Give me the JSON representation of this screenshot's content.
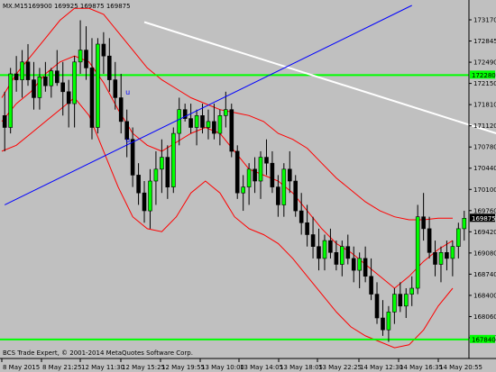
{
  "header": {
    "symbol": "MX.M15",
    "ohlc": "169900 169925 169875 169875"
  },
  "footer": {
    "copyright": "BCS Trade Expert, © 2001-2014 MetaQuotes Software Corp."
  },
  "colors": {
    "background": "#c0c0c0",
    "bull_body": "#00ff00",
    "bear_body": "#000000",
    "bollinger": "#ff0000",
    "hline": "#00ff00",
    "trendline_down": "#ffffff",
    "trendline_up": "#ffff00",
    "trendline_blue": "#0000ff"
  },
  "price_axis": {
    "labels": [
      "173170",
      "172845",
      "172490",
      "172150",
      "171810",
      "171120",
      "170780",
      "170440",
      "170100",
      "169760",
      "169420",
      "169080",
      "168740",
      "168400",
      "168060",
      "167720"
    ],
    "current_price": "169875",
    "hline_upper_tag": "172280",
    "hline_lower_tag": "167840"
  },
  "time_axis": {
    "labels": [
      "8 May 2015",
      "8 May 21:25",
      "12 May 11:30",
      "12 May 15:25",
      "12 May 19:55",
      "13 May 10:00",
      "13 May 14:05",
      "13 May 18:05",
      "13 May 22:25",
      "14 May 12:30",
      "14 May 16:35",
      "14 May 20:55"
    ]
  },
  "markers": [
    {
      "text": "u"
    },
    {
      "text": "u"
    }
  ],
  "chart_data": {
    "type": "candlestick",
    "timeframe": "M15",
    "symbol": "MX",
    "y_range": [
      167550,
      173450
    ],
    "horizontal_lines": [
      172280,
      167840
    ],
    "trend_lines": [
      {
        "name": "white",
        "from": [
          24,
          173170
        ],
        "to": [
          125,
          170050
        ]
      },
      {
        "name": "yellow",
        "from": [
          106,
          167760
        ],
        "to": [
          142,
          169350
        ]
      },
      {
        "name": "blue",
        "from": [
          0,
          170100
        ],
        "to": [
          70,
          173450
        ]
      }
    ],
    "bollinger": {
      "upper": [
        171900,
        172300,
        172600,
        172900,
        173200,
        173400,
        173400,
        173300,
        173000,
        172700,
        172400,
        172200,
        172050,
        171900,
        171800,
        171700,
        171650,
        171600,
        171500,
        171300,
        171200,
        171050,
        170800,
        170550,
        170350,
        170150,
        170000,
        169900,
        169850,
        169850,
        169875,
        169875
      ],
      "middle": [
        171500,
        171800,
        172000,
        172300,
        172500,
        172600,
        172500,
        172150,
        171700,
        171300,
        171100,
        171000,
        171150,
        171300,
        171400,
        171300,
        171000,
        170700,
        170600,
        170500,
        170300,
        170000,
        169700,
        169450,
        169300,
        169100,
        168900,
        168700,
        168900,
        169150,
        169350,
        169500
      ],
      "lower": [
        171000,
        171100,
        171300,
        171500,
        171700,
        171900,
        171600,
        171000,
        170400,
        169900,
        169700,
        169650,
        169900,
        170300,
        170500,
        170300,
        169900,
        169700,
        169600,
        169450,
        169200,
        168900,
        168600,
        168300,
        168050,
        167900,
        167800,
        167700,
        167750,
        168000,
        168400,
        168700
      ]
    },
    "candles": [
      [
        171600,
        172000,
        171000,
        171400
      ],
      [
        171400,
        172400,
        171300,
        172300
      ],
      [
        172300,
        172600,
        172000,
        172200
      ],
      [
        172200,
        172700,
        171900,
        172500
      ],
      [
        172500,
        172800,
        172100,
        172200
      ],
      [
        172200,
        172500,
        171700,
        171900
      ],
      [
        171900,
        172400,
        171700,
        172250
      ],
      [
        172250,
        172500,
        172000,
        172100
      ],
      [
        172100,
        172400,
        171900,
        172350
      ],
      [
        172350,
        172700,
        172100,
        172150
      ],
      [
        172150,
        172500,
        171600,
        172000
      ],
      [
        172000,
        172200,
        171400,
        171800
      ],
      [
        171800,
        172600,
        171400,
        172500
      ],
      [
        172500,
        173200,
        172300,
        172700
      ],
      [
        172700,
        173100,
        172200,
        172400
      ],
      [
        172400,
        172900,
        171200,
        171400
      ],
      [
        171400,
        172900,
        171300,
        172800
      ],
      [
        172800,
        173000,
        172300,
        172600
      ],
      [
        172600,
        172900,
        172000,
        172200
      ],
      [
        172200,
        172500,
        171700,
        171900
      ],
      [
        171900,
        172300,
        171300,
        171500
      ],
      [
        171500,
        171700,
        170900,
        171200
      ],
      [
        171200,
        171400,
        170400,
        170600
      ],
      [
        170600,
        170800,
        170100,
        170300
      ],
      [
        170300,
        170500,
        169800,
        170000
      ],
      [
        170000,
        170700,
        169700,
        170500
      ],
      [
        170500,
        171000,
        170100,
        170700
      ],
      [
        170700,
        171200,
        170300,
        170900
      ],
      [
        170900,
        171100,
        170200,
        170400
      ],
      [
        170400,
        171400,
        170300,
        171300
      ],
      [
        171300,
        171900,
        171100,
        171700
      ],
      [
        171700,
        171800,
        171500,
        171550
      ],
      [
        171550,
        171800,
        171300,
        171400
      ],
      [
        171400,
        171700,
        171100,
        171600
      ],
      [
        171600,
        171800,
        171300,
        171400
      ],
      [
        171400,
        171700,
        171200,
        171500
      ],
      [
        171500,
        171800,
        171200,
        171300
      ],
      [
        171300,
        171700,
        171100,
        171600
      ],
      [
        171600,
        172000,
        171400,
        171700
      ],
      [
        171700,
        171800,
        170900,
        171000
      ],
      [
        171000,
        171100,
        170200,
        170300
      ],
      [
        170300,
        170600,
        170000,
        170400
      ],
      [
        170400,
        170800,
        170100,
        170700
      ],
      [
        170700,
        170900,
        170300,
        170500
      ],
      [
        170500,
        171000,
        170200,
        170900
      ],
      [
        170900,
        171200,
        170600,
        170800
      ],
      [
        170800,
        171000,
        170300,
        170400
      ],
      [
        170400,
        170600,
        169900,
        170100
      ],
      [
        170100,
        170800,
        169900,
        170700
      ],
      [
        170700,
        171000,
        170300,
        170500
      ],
      [
        170500,
        170600,
        169900,
        170000
      ],
      [
        170000,
        170300,
        169600,
        169800
      ],
      [
        169800,
        170100,
        169400,
        169600
      ],
      [
        169600,
        169900,
        169200,
        169400
      ],
      [
        169400,
        169700,
        169000,
        169200
      ],
      [
        169200,
        169600,
        169000,
        169500
      ],
      [
        169500,
        169700,
        169200,
        169300
      ],
      [
        169300,
        169500,
        169000,
        169100
      ],
      [
        169100,
        169500,
        168900,
        169400
      ],
      [
        169400,
        169600,
        169100,
        169200
      ],
      [
        169200,
        169400,
        168800,
        169000
      ],
      [
        169000,
        169300,
        168700,
        169200
      ],
      [
        169200,
        169400,
        168800,
        168900
      ],
      [
        168900,
        169200,
        168500,
        168600
      ],
      [
        168600,
        168800,
        168100,
        168200
      ],
      [
        168200,
        168500,
        167900,
        168000
      ],
      [
        168000,
        168400,
        167800,
        168300
      ],
      [
        168300,
        168700,
        168100,
        168600
      ],
      [
        168600,
        168800,
        168300,
        168400
      ],
      [
        168400,
        168700,
        168200,
        168600
      ],
      [
        168600,
        168900,
        168400,
        168700
      ],
      [
        168700,
        170100,
        168600,
        169900
      ],
      [
        169900,
        170300,
        169500,
        169700
      ],
      [
        169700,
        169900,
        169200,
        169300
      ],
      [
        169300,
        169500,
        168900,
        169100
      ],
      [
        169100,
        169400,
        168800,
        169300
      ],
      [
        169300,
        169500,
        169000,
        169200
      ],
      [
        169200,
        169500,
        168900,
        169400
      ],
      [
        169400,
        169800,
        169200,
        169700
      ],
      [
        169700,
        170000,
        169500,
        169875
      ]
    ]
  }
}
